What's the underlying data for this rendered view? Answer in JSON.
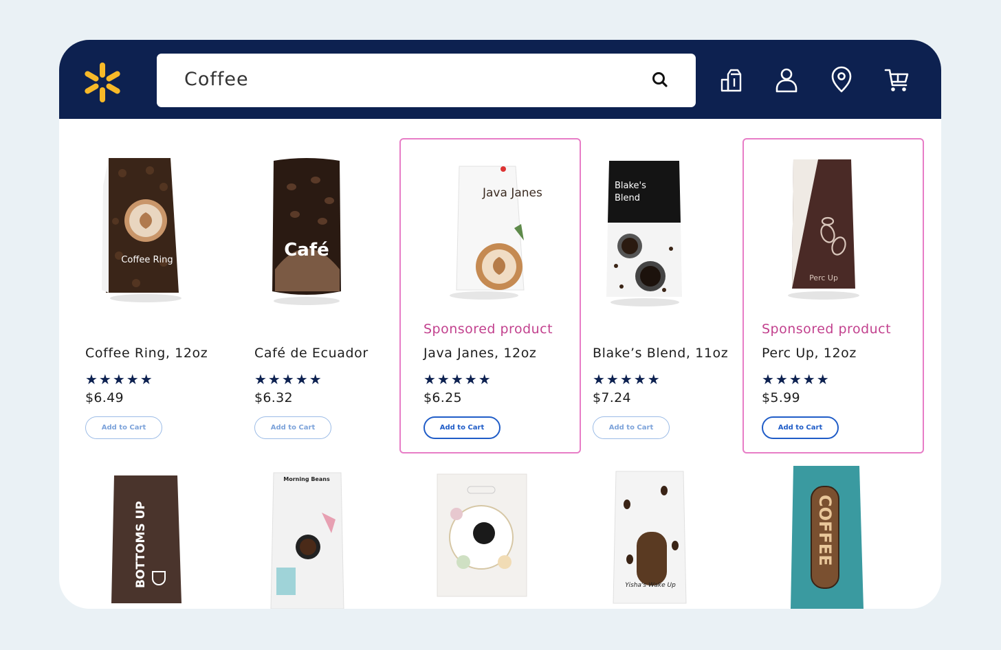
{
  "header": {
    "search_value": "Coffee",
    "brand_color": "#0d2150",
    "logo_color": "#f7b928",
    "icons": [
      "spark-logo-icon",
      "search-icon",
      "reorder-icon",
      "account-icon",
      "location-pin-icon",
      "cart-icon"
    ]
  },
  "sponsored_color": "#c2418e",
  "products": [
    {
      "name": "Coffee Ring, 12oz",
      "rating": "★★★★★",
      "price": "$6.49",
      "button": "Add to Cart",
      "sponsored": false,
      "package_text": "Coffee Ring"
    },
    {
      "name": "Café de Ecuador",
      "rating": "★★★★★",
      "price": "$6.32",
      "button": "Add to Cart",
      "sponsored": false,
      "package_text": "Café"
    },
    {
      "name": "Java Janes, 12oz",
      "rating": "★★★★★",
      "price": "$6.25",
      "button": "Add to Cart",
      "sponsored": true,
      "sponsored_label": "Sponsored product",
      "package_text": "Java Janes"
    },
    {
      "name": "Blake’s Blend, 11oz",
      "rating": "★★★★★",
      "price": "$7.24",
      "button": "Add to Cart",
      "sponsored": false,
      "package_text": "Blake's Blend"
    },
    {
      "name": "Perc Up, 12oz",
      "rating": "★★★★★",
      "price": "$5.99",
      "button": "Add to Cart",
      "sponsored": true,
      "sponsored_label": "Sponsored product",
      "package_text": "Perc Up"
    }
  ],
  "second_row_packages": [
    "BOTTOMS UP",
    "Morning Beans",
    "",
    "Yisha's Wake Up",
    "COFFEE"
  ]
}
